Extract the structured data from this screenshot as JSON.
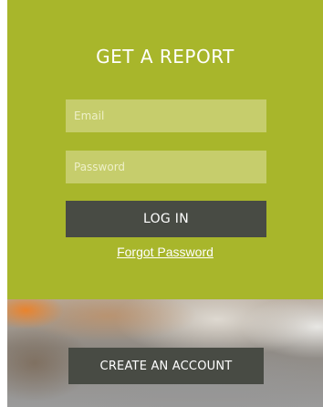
{
  "login": {
    "title": "GET A REPORT",
    "email_placeholder": "Email",
    "email_value": "",
    "password_placeholder": "Password",
    "password_value": "",
    "login_label": "LOG IN",
    "forgot_label": "Forgot Password"
  },
  "signup": {
    "create_account_label": "CREATE AN ACCOUNT"
  },
  "colors": {
    "card_background": "#a8b62b",
    "field_background": "#c6cd6c",
    "button_background": "#484b44",
    "text": "#ffffff"
  }
}
